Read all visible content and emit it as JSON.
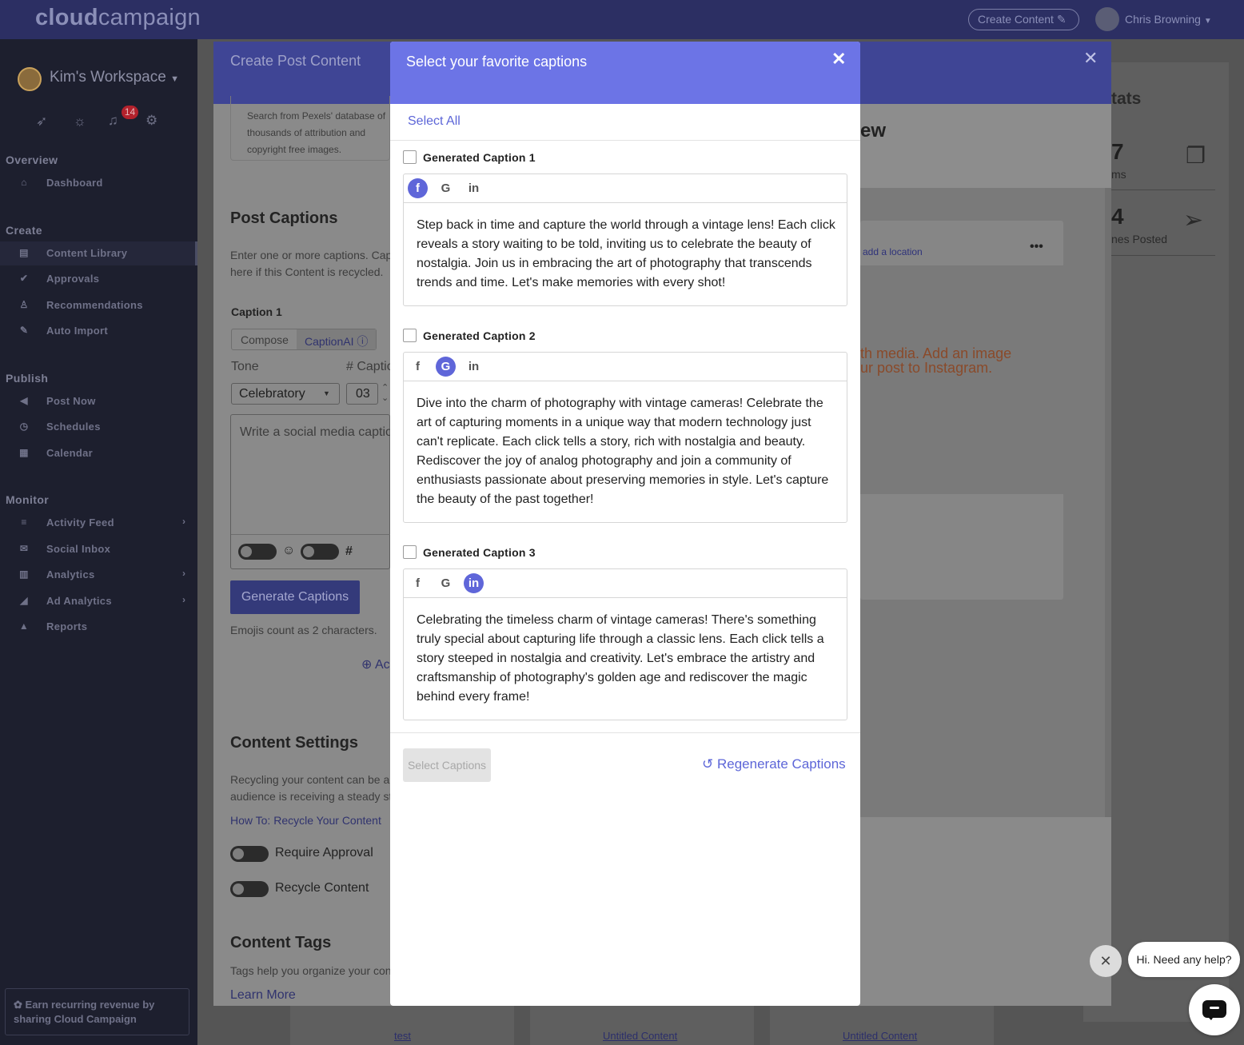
{
  "app": {
    "logo_bold": "cloud",
    "logo_rest": "campaign",
    "create_content": "Create Content",
    "user_name": "Chris Browning"
  },
  "sidebar": {
    "workspace": "Kim's Workspace",
    "notification_count": "14",
    "sections": [
      {
        "title": "Overview",
        "items": [
          {
            "label": "Dashboard",
            "icon": "home-icon"
          }
        ]
      },
      {
        "title": "Create",
        "items": [
          {
            "label": "Content Library",
            "icon": "file-icon"
          },
          {
            "label": "Approvals",
            "icon": "check-circle-icon"
          },
          {
            "label": "Recommendations",
            "icon": "flask-icon"
          },
          {
            "label": "Auto Import",
            "icon": "magic-wand-icon"
          }
        ]
      },
      {
        "title": "Publish",
        "items": [
          {
            "label": "Post Now",
            "icon": "bullhorn-icon"
          },
          {
            "label": "Schedules",
            "icon": "clock-icon"
          },
          {
            "label": "Calendar",
            "icon": "calendar-icon"
          }
        ]
      },
      {
        "title": "Monitor",
        "items": [
          {
            "label": "Activity Feed",
            "icon": "list-icon"
          },
          {
            "label": "Social Inbox",
            "icon": "envelope-icon"
          },
          {
            "label": "Analytics",
            "icon": "bar-chart-icon"
          },
          {
            "label": "Ad Analytics",
            "icon": "line-chart-icon"
          },
          {
            "label": "Reports",
            "icon": "area-chart-icon"
          }
        ]
      }
    ],
    "earn": "Earn recurring revenue by sharing Cloud Campaign"
  },
  "background": {
    "stats_title": "tats",
    "stat1_value": "7",
    "stat1_label": "ms",
    "stat2_value": "4",
    "stat2_label": "nes Posted",
    "preview_title": "ew",
    "add_location": "add a location",
    "instagram_warning_1": "th media. Add an image",
    "instagram_warning_2": "ur post to Instagram.",
    "library_items": [
      "test",
      "Untitled Content",
      "Untitled Content"
    ]
  },
  "create_post": {
    "title": "Create Post Content",
    "pexels_1": "Search from Pexels' database of",
    "pexels_2": "thousands of attribution and",
    "pexels_3": "copyright free images.",
    "post_captions": "Post Captions",
    "captions_desc_1": "Enter one or more captions. Cap",
    "captions_desc_2": "here if this Content is recycled.",
    "caption_label": "Caption 1",
    "tab_compose": "Compose",
    "tab_captionai": "CaptionAI",
    "tone_label": "Tone",
    "num_captions_label": "# Captio",
    "tone_value": "Celebratory",
    "num_value": "03",
    "prompt_placeholder": "Write a social media captio",
    "generate": "Generate Captions",
    "emoji_note": "Emojis count as 2 characters.",
    "add_caption": "Ac",
    "content_settings": "Content Settings",
    "recycle_desc_1": "Recycling your content can be a",
    "recycle_desc_2": "audience is receiving a steady st",
    "recycle_link": "How To: Recycle Your Content",
    "require_approval": "Require Approval",
    "recycle_content": "Recycle Content",
    "content_tags": "Content Tags",
    "tags_desc": "Tags help you organize your con",
    "learn_more": "Learn More"
  },
  "modal": {
    "title": "Select your favorite captions",
    "select_all": "Select All",
    "captions": [
      {
        "title": "Generated Caption 1",
        "active": "facebook",
        "text": "Step back in time and capture the world through a vintage lens! Each click reveals a story waiting to be told, inviting us to celebrate the beauty of nostalgia. Join us in embracing the art of photography that transcends trends and time. Let's make memories with every shot!"
      },
      {
        "title": "Generated Caption 2",
        "active": "google",
        "text": "Dive into the charm of photography with vintage cameras! Celebrate the art of capturing moments in a unique way that modern technology just can't replicate. Each click tells a story, rich with nostalgia and beauty. Rediscover the joy of analog photography and join a community of enthusiasts passionate about preserving memories in style. Let's capture the beauty of the past together!"
      },
      {
        "title": "Generated Caption 3",
        "active": "linkedin",
        "text": "Celebrating the timeless charm of vintage cameras! There's something truly special about capturing life through a classic lens. Each click tells a story steeped in nostalgia and creativity. Let's embrace the artistry and craftsmanship of photography's golden age and rediscover the magic behind every frame!"
      }
    ],
    "select_captions": "Select Captions",
    "regenerate": "Regenerate Captions"
  },
  "chat": {
    "prompt": "Hi. Need any help?"
  },
  "colors": {
    "accent": "#6c74e6",
    "link": "#5d66d8",
    "topbar": "#2c2f63"
  }
}
